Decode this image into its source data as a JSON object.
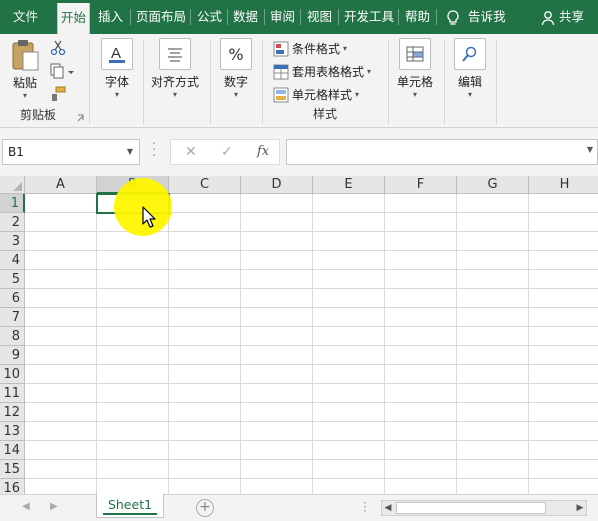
{
  "tabs": [
    {
      "label": "文件",
      "active": false
    },
    {
      "label": "开始",
      "active": true
    },
    {
      "label": "插入",
      "active": false
    },
    {
      "label": "页面布局",
      "active": false
    },
    {
      "label": "公式",
      "active": false
    },
    {
      "label": "数据",
      "active": false
    },
    {
      "label": "审阅",
      "active": false
    },
    {
      "label": "视图",
      "active": false
    },
    {
      "label": "开发工具",
      "active": false
    },
    {
      "label": "帮助",
      "active": false
    }
  ],
  "tell_me": "告诉我",
  "share": "共享",
  "ribbon": {
    "clipboard": {
      "paste": "粘贴",
      "group_label": "剪贴板"
    },
    "font": {
      "label": "字体"
    },
    "alignment": {
      "label": "对齐方式"
    },
    "number": {
      "label": "数字"
    },
    "styles": {
      "conditional": "条件格式",
      "table_format": "套用表格格式",
      "cell_style": "单元格样式",
      "group_label": "样式"
    },
    "cells": {
      "label": "单元格"
    },
    "editing": {
      "label": "编辑"
    }
  },
  "name_box": "B1",
  "formula_value": "",
  "columns": [
    "A",
    "B",
    "C",
    "D",
    "E",
    "F",
    "G",
    "H"
  ],
  "rows": [
    "1",
    "2",
    "3",
    "4",
    "5",
    "6",
    "7",
    "8",
    "9",
    "10",
    "11",
    "12",
    "13",
    "14",
    "15",
    "16"
  ],
  "selected_cell": "B1",
  "sheet_tabs": [
    "Sheet1"
  ],
  "colors": {
    "accent": "#217346",
    "highlight": "#fff500"
  }
}
